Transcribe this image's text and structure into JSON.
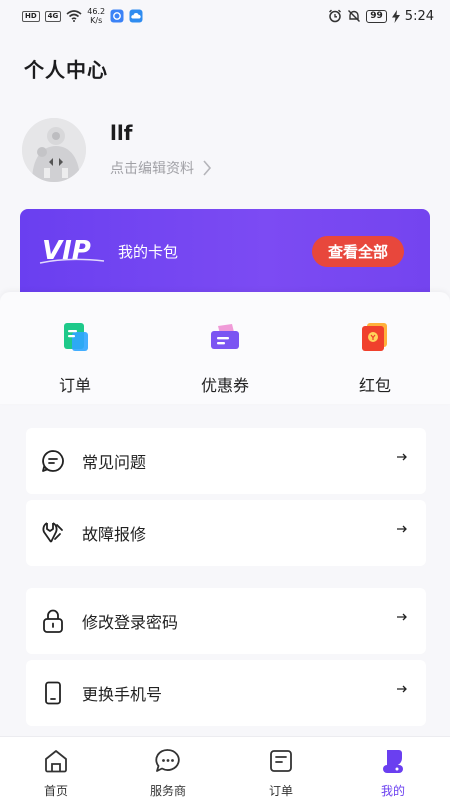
{
  "status_bar": {
    "hd": "HD",
    "network": "4G",
    "speed_value": "46.2",
    "speed_unit": "K/s",
    "battery": "99",
    "time": "5:24"
  },
  "header": {
    "title": "个人中心"
  },
  "profile": {
    "username": "llf",
    "edit_label": "点击编辑资料"
  },
  "vip": {
    "logo_text": "VIP",
    "wallet_label": "我的卡包",
    "view_all_label": "查看全部",
    "accent": "#6a3ff0",
    "button_color": "#e8473c"
  },
  "quick_actions": [
    {
      "label": "订单",
      "icon": "order-document-icon"
    },
    {
      "label": "优惠券",
      "icon": "coupon-icon"
    },
    {
      "label": "红包",
      "icon": "red-envelope-icon"
    }
  ],
  "menu": {
    "group1": [
      {
        "label": "常见问题",
        "icon": "faq-chat-icon"
      },
      {
        "label": "故障报修",
        "icon": "wrench-icon"
      }
    ],
    "group2": [
      {
        "label": "修改登录密码",
        "icon": "lock-icon"
      },
      {
        "label": "更换手机号",
        "icon": "phone-icon"
      }
    ]
  },
  "tab_bar": {
    "items": [
      {
        "label": "首页",
        "icon": "home-icon"
      },
      {
        "label": "服务商",
        "icon": "message-icon"
      },
      {
        "label": "订单",
        "icon": "order-icon"
      },
      {
        "label": "我的",
        "icon": "profile-icon",
        "active": true
      }
    ]
  }
}
